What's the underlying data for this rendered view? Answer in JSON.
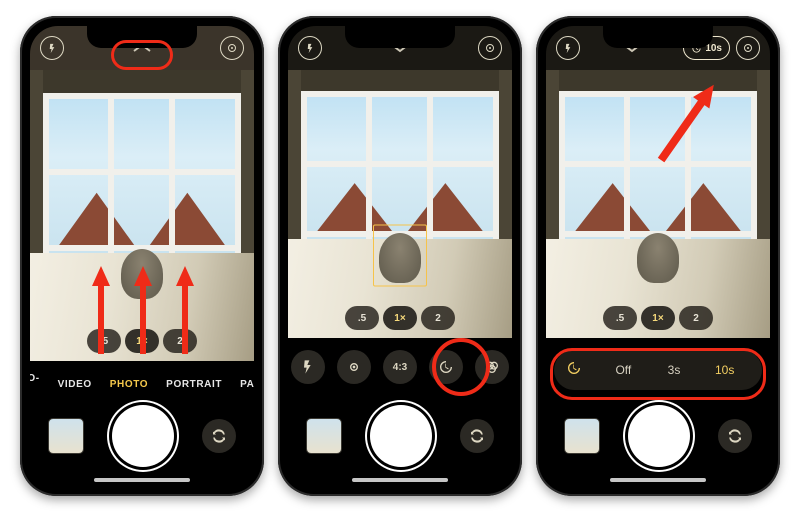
{
  "colors": {
    "accent": "#f6c94c",
    "highlight": "#ef2b18"
  },
  "zoom": {
    "opt1": ".5",
    "opt2": "1×",
    "opt3": "2"
  },
  "modes": {
    "slomo": "SLO-MO",
    "video": "VIDEO",
    "photo": "PHOTO",
    "portrait": "PORTRAIT",
    "pano": "PANO"
  },
  "ctrl": {
    "ratio": "4:3"
  },
  "timer_badge": "10s",
  "timer": {
    "off": "Off",
    "t3": "3s",
    "t10": "10s"
  },
  "icons": {
    "flash": "flash-off-icon",
    "live": "live-photo-icon",
    "chevron_up": "chevron-up-icon",
    "chevron_down": "chevron-down-icon",
    "timer": "timer-icon",
    "filters": "filters-icon",
    "switch": "switch-camera-icon",
    "thumbnail": "last-photo-thumbnail",
    "shutter": "shutter-button"
  }
}
